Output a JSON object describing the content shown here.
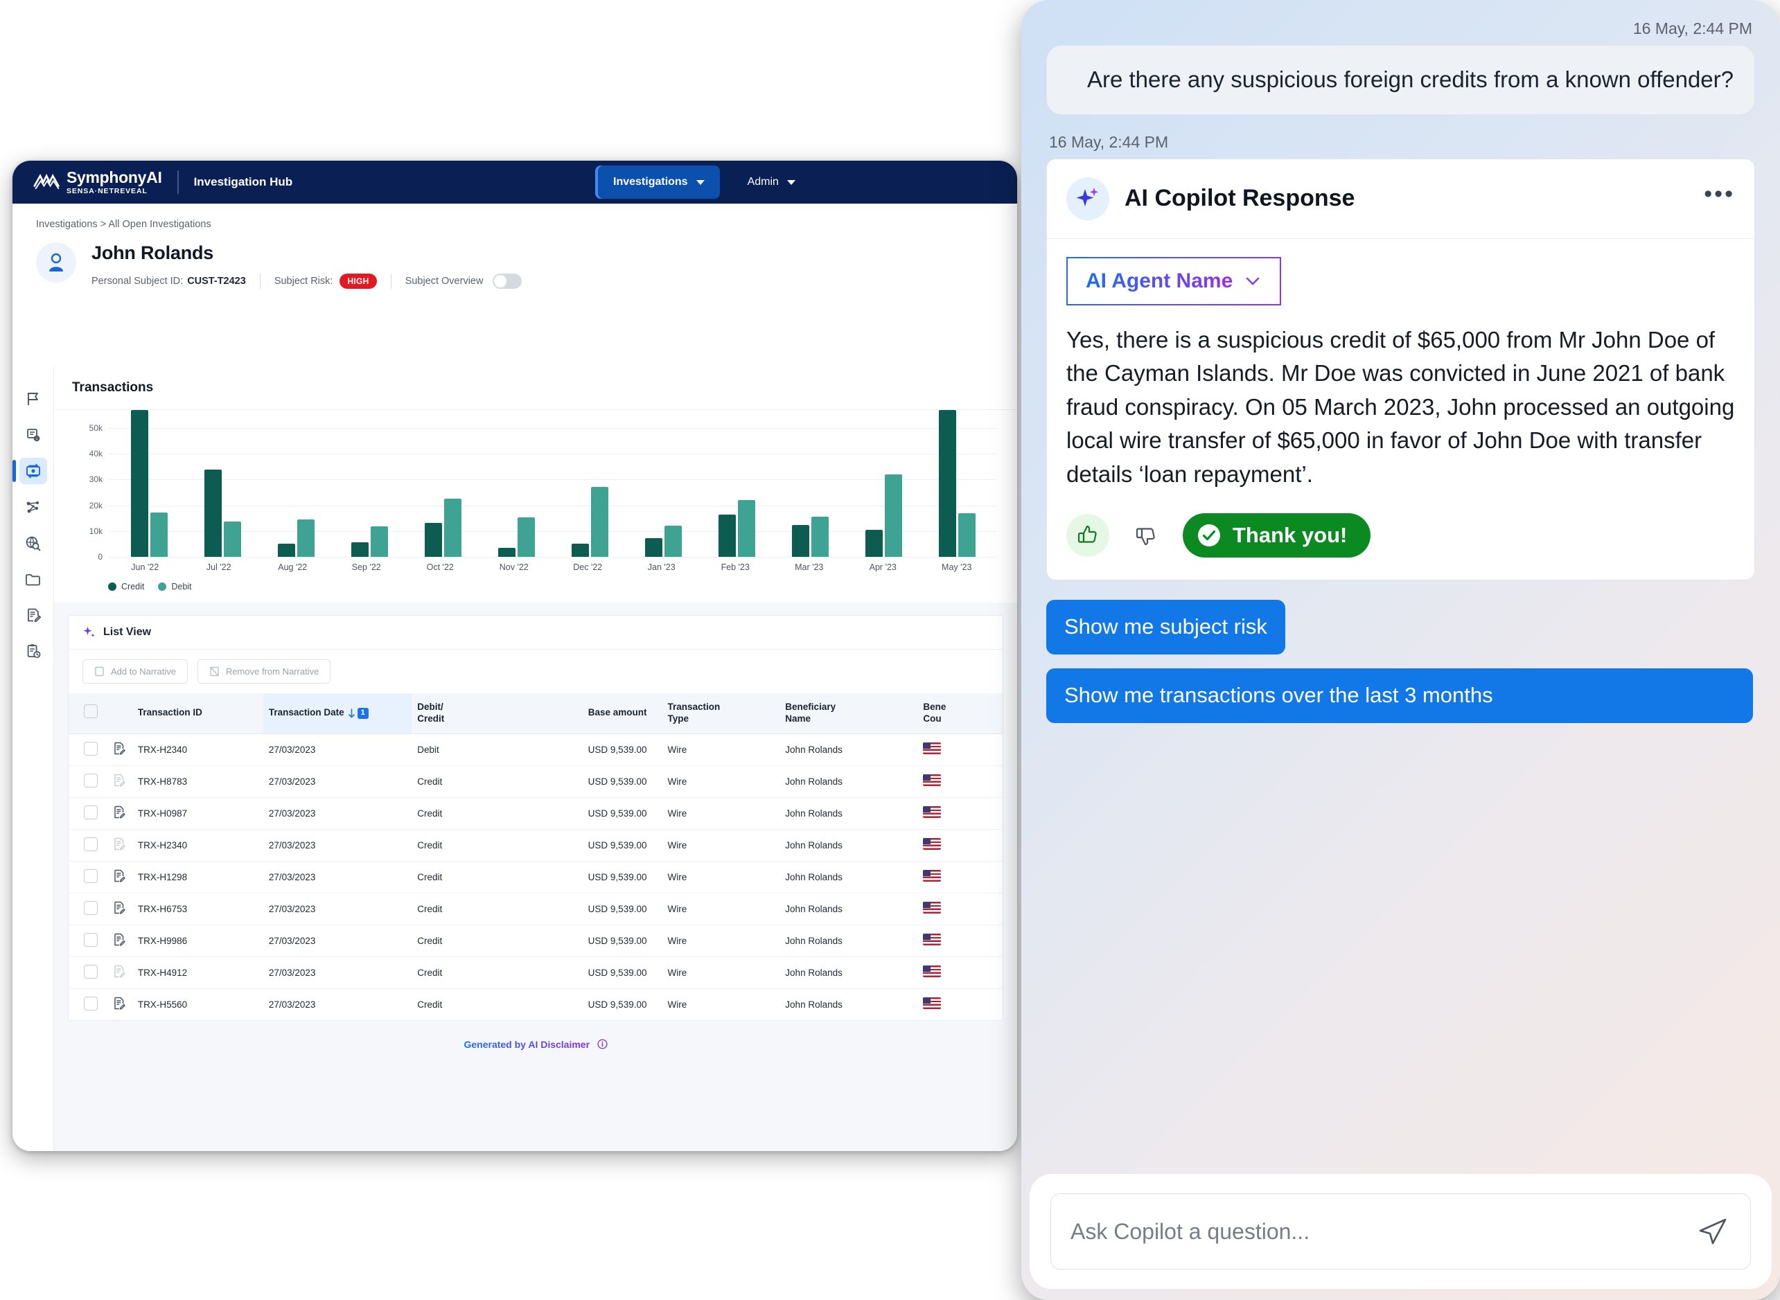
{
  "app": {
    "brand": {
      "name": "SymphonyAI",
      "sub": "SENSA·NETREVEAL",
      "logo_icon": "symphony-wave-logo"
    },
    "hub_title": "Investigation Hub",
    "nav": [
      {
        "label": "Investigations",
        "active": true
      },
      {
        "label": "Admin",
        "active": false
      }
    ],
    "breadcrumb": "Investigations > All Open Investigations",
    "subject": {
      "name": "John Rolands",
      "id_label": "Personal Subject ID:",
      "id_value": "CUST-T2423",
      "risk_label": "Subject Risk:",
      "risk_value": "HIGH",
      "risk_color": "#e01b24",
      "overview_label": "Subject Overview",
      "overview_on": false
    },
    "sidebar": [
      {
        "name": "flag-icon",
        "active": false
      },
      {
        "name": "document-info-icon",
        "active": false
      },
      {
        "name": "transactions-icon",
        "active": true
      },
      {
        "name": "network-graph-icon",
        "active": false
      },
      {
        "name": "globe-search-icon",
        "active": false
      },
      {
        "name": "folder-icon",
        "active": false
      },
      {
        "name": "document-edit-icon",
        "active": false
      },
      {
        "name": "clipboard-clock-icon",
        "active": false
      }
    ],
    "panel_title": "Transactions",
    "list_view": {
      "title": "List View",
      "sparkle_icon": "ai-sparkle-icon",
      "actions": [
        {
          "label": "Add to Narrative",
          "icon": "add-note-icon",
          "disabled": true
        },
        {
          "label": "Remove from Narrative",
          "icon": "remove-note-icon",
          "disabled": true
        }
      ],
      "columns": [
        "Transaction ID",
        "Transaction Date",
        "Debit/ Credit",
        "Base amount",
        "Transaction Type",
        "Beneficiary Name",
        "Bene Cou"
      ],
      "sort_column": "Transaction Date",
      "sort_badge": "1",
      "rows": [
        {
          "id": "TRX-H2340",
          "date": "27/03/2023",
          "dc": "Debit",
          "amount": "USD 9,539.00",
          "type": "Wire",
          "beneficiary": "John Rolands",
          "country": "us-flag"
        },
        {
          "id": "TRX-H8783",
          "date": "27/03/2023",
          "dc": "Credit",
          "amount": "USD 9,539.00",
          "type": "Wire",
          "beneficiary": "John Rolands",
          "country": "us-flag"
        },
        {
          "id": "TRX-H0987",
          "date": "27/03/2023",
          "dc": "Credit",
          "amount": "USD 9,539.00",
          "type": "Wire",
          "beneficiary": "John Rolands",
          "country": "us-flag"
        },
        {
          "id": "TRX-H2340",
          "date": "27/03/2023",
          "dc": "Credit",
          "amount": "USD 9,539.00",
          "type": "Wire",
          "beneficiary": "John Rolands",
          "country": "us-flag"
        },
        {
          "id": "TRX-H1298",
          "date": "27/03/2023",
          "dc": "Credit",
          "amount": "USD 9,539.00",
          "type": "Wire",
          "beneficiary": "John Rolands",
          "country": "us-flag"
        },
        {
          "id": "TRX-H6753",
          "date": "27/03/2023",
          "dc": "Credit",
          "amount": "USD 9,539.00",
          "type": "Wire",
          "beneficiary": "John Rolands",
          "country": "us-flag"
        },
        {
          "id": "TRX-H9986",
          "date": "27/03/2023",
          "dc": "Credit",
          "amount": "USD 9,539.00",
          "type": "Wire",
          "beneficiary": "John Rolands",
          "country": "us-flag"
        },
        {
          "id": "TRX-H4912",
          "date": "27/03/2023",
          "dc": "Credit",
          "amount": "USD 9,539.00",
          "type": "Wire",
          "beneficiary": "John Rolands",
          "country": "us-flag"
        },
        {
          "id": "TRX-H5560",
          "date": "27/03/2023",
          "dc": "Credit",
          "amount": "USD 9,539.00",
          "type": "Wire",
          "beneficiary": "John Rolands",
          "country": "us-flag"
        }
      ]
    },
    "disclaimer": {
      "text": "Generated by AI Disclaimer",
      "icon": "info-circle-icon"
    }
  },
  "chart_data": {
    "type": "bar",
    "title": "Transactions",
    "xlabel": "",
    "ylabel": "",
    "ylim": [
      0,
      57000
    ],
    "yticks": [
      "0",
      "10k",
      "20k",
      "30k",
      "40k",
      "50k"
    ],
    "ytick_values": [
      0,
      10000,
      20000,
      30000,
      40000,
      50000
    ],
    "grid": true,
    "legend_position": "bottom-left",
    "categories": [
      "Jun '22",
      "Jul '22",
      "Aug '22",
      "Sep '22",
      "Oct '22",
      "Nov '22",
      "Dec '22",
      "Jan '23",
      "Feb '23",
      "Mar '23",
      "Apr '23",
      "May '23"
    ],
    "series": [
      {
        "name": "Credit",
        "color": "#0d5c52",
        "values": [
          57000,
          33800,
          5200,
          5700,
          13200,
          3400,
          5000,
          7300,
          16500,
          12400,
          10500,
          57000
        ]
      },
      {
        "name": "Debit",
        "color": "#3fa393",
        "values": [
          17300,
          13700,
          14500,
          11700,
          22500,
          15300,
          27200,
          12100,
          22100,
          15700,
          32100,
          17000
        ]
      }
    ]
  },
  "chat": {
    "timestamp_user": "16 May, 2:44 PM",
    "user_message": "Are there any suspicious foreign credits from a known offender?",
    "timestamp_ai": "16 May, 2:44 PM",
    "ai_card": {
      "title": "AI Copilot Response",
      "sparkle_icon": "ai-sparkle-icon",
      "more_icon": "more-horizontal-icon",
      "agent_selector": {
        "label": "AI Agent Name",
        "chevron_icon": "chevron-down-icon"
      },
      "body": "Yes, there is a suspicious credit of $65,000 from Mr John Doe of the Cayman Islands. Mr Doe was convicted in June 2021 of bank fraud conspiracy. On 05 March 2023, John processed an outgoing local wire transfer of $65,000 in favor of John Doe with transfer details ‘loan repayment’.",
      "feedback": {
        "thumbs_up_icon": "thumbs-up-icon",
        "thumbs_down_icon": "thumbs-down-icon",
        "confirmation_label": "Thank you!",
        "confirmation_icon": "check-circle-icon",
        "confirmation_color": "#0a8a21"
      }
    },
    "suggestions": [
      "Show me subject risk",
      "Show me transactions over the last 3 months"
    ],
    "composer": {
      "placeholder": "Ask Copilot a question...",
      "send_icon": "send-icon"
    }
  }
}
